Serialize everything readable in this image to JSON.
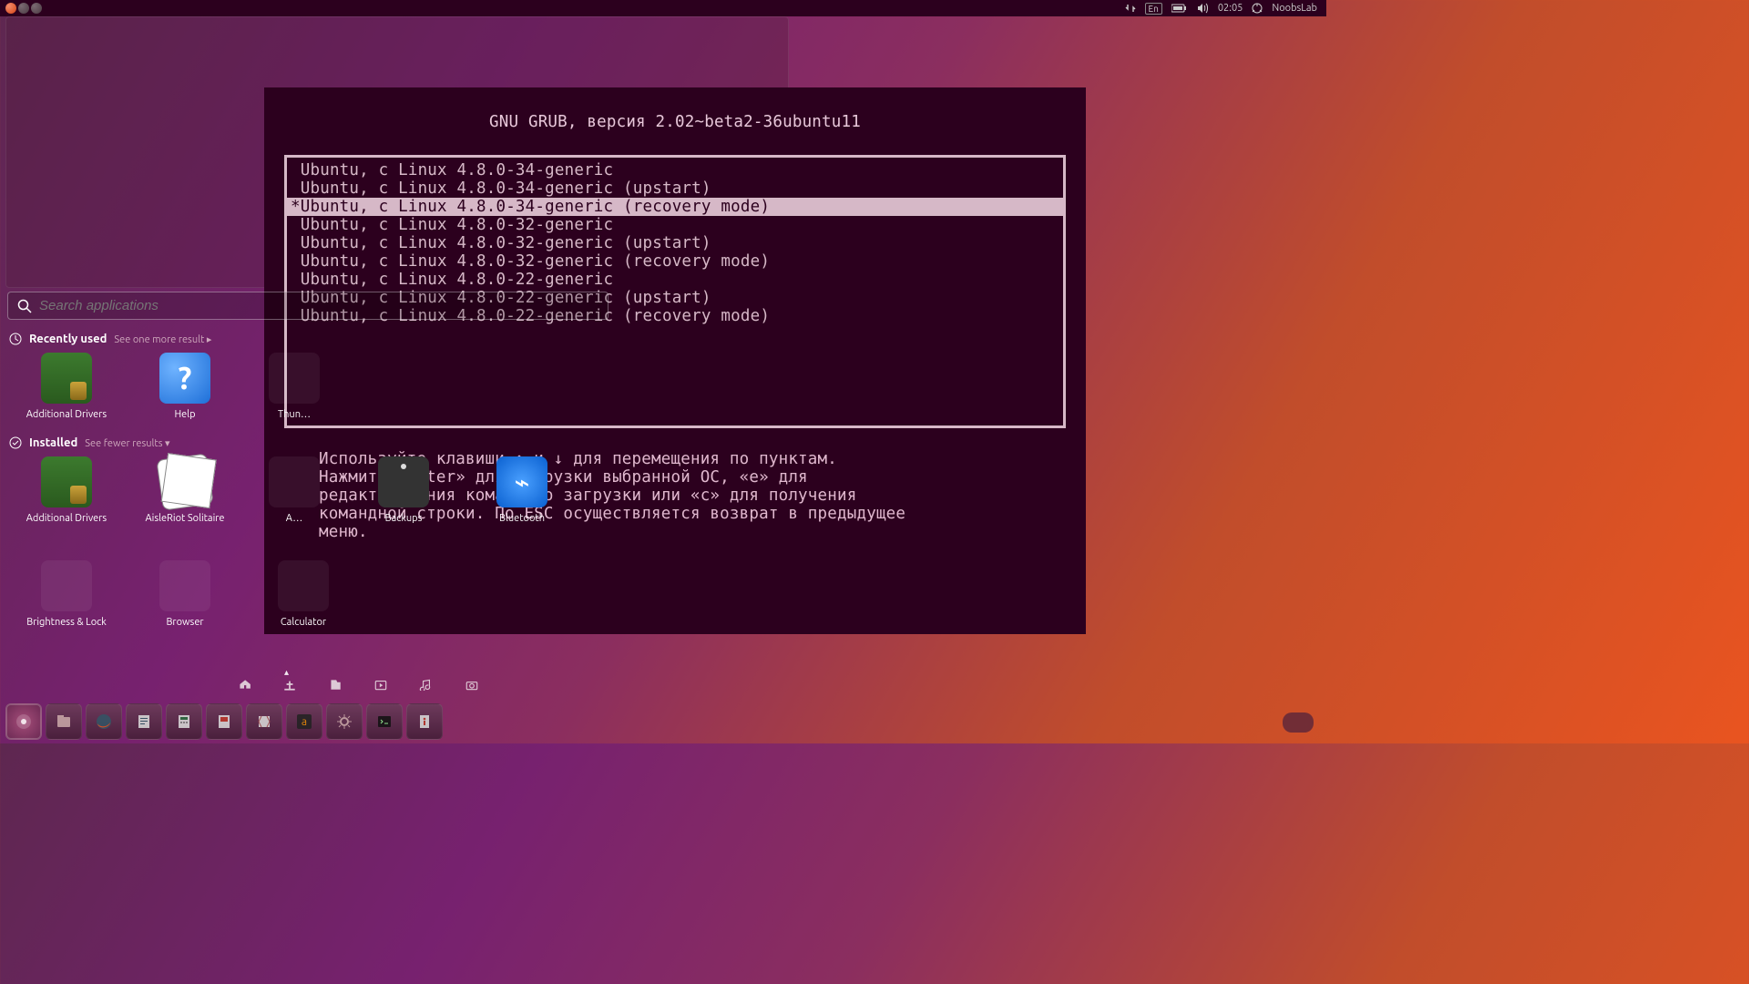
{
  "topbar": {
    "lang": "En",
    "time": "02:05",
    "user": "NoobsLab"
  },
  "grub": {
    "title": "GNU GRUB, версия 2.02~beta2-36ubuntu11",
    "entries": [
      {
        "prefix": " ",
        "text": "Ubuntu, с Linux 4.8.0-34-generic"
      },
      {
        "prefix": " ",
        "text": "Ubuntu, с Linux 4.8.0-34-generic (upstart)"
      },
      {
        "prefix": "*",
        "text": "Ubuntu, с Linux 4.8.0-34-generic (recovery mode)",
        "selected": true
      },
      {
        "prefix": " ",
        "text": "Ubuntu, с Linux 4.8.0-32-generic"
      },
      {
        "prefix": " ",
        "text": "Ubuntu, с Linux 4.8.0-32-generic (upstart)"
      },
      {
        "prefix": " ",
        "text": "Ubuntu, с Linux 4.8.0-32-generic (recovery mode)"
      },
      {
        "prefix": " ",
        "text": "Ubuntu, с Linux 4.8.0-22-generic"
      },
      {
        "prefix": " ",
        "text": "Ubuntu, с Linux 4.8.0-22-generic (upstart)"
      },
      {
        "prefix": " ",
        "text": "Ubuntu, с Linux 4.8.0-22-generic (recovery mode)"
      }
    ],
    "help": "Используйте клавиши ↑ и ↓ для перемещения по пунктам.\nНажмите «enter» для загрузки выбранной ОС, «e» для\nредактирования команд до загрузки или «c» для получения\nкомандной строки. По ESC осуществляется возврат в предыдущее\nменю."
  },
  "dash": {
    "search_placeholder": "Search applications",
    "recent": {
      "title": "Recently used",
      "hint": "See one more result  ▸",
      "apps": [
        {
          "label": "Additional Drivers",
          "icon": "chip"
        },
        {
          "label": "Help",
          "icon": "help"
        },
        {
          "label": "Thun…",
          "icon": "blank",
          "clip": true
        }
      ]
    },
    "installed": {
      "title": "Installed",
      "hint": "See fewer results  ▾",
      "apps": [
        {
          "label": "Additional Drivers",
          "icon": "chip"
        },
        {
          "label": "AisleRiot Solitaire",
          "icon": "cards"
        },
        {
          "label": "A…",
          "icon": "blank",
          "clip": true
        },
        {
          "label": "Backups",
          "icon": "safe"
        },
        {
          "label": "Bluetooth",
          "icon": "bt"
        },
        {
          "label": "Brightness & Lock",
          "icon": "blank"
        },
        {
          "label": "Browser",
          "icon": "blank"
        },
        {
          "label": "Calculator",
          "icon": "blank"
        }
      ]
    },
    "categories": [
      "home",
      "apps",
      "files",
      "video",
      "music",
      "photo"
    ]
  },
  "dock": {
    "items": [
      "ubuntu",
      "files",
      "firefox",
      "writer",
      "calc",
      "impress",
      "software",
      "amazon",
      "settings",
      "terminal",
      "info"
    ]
  }
}
